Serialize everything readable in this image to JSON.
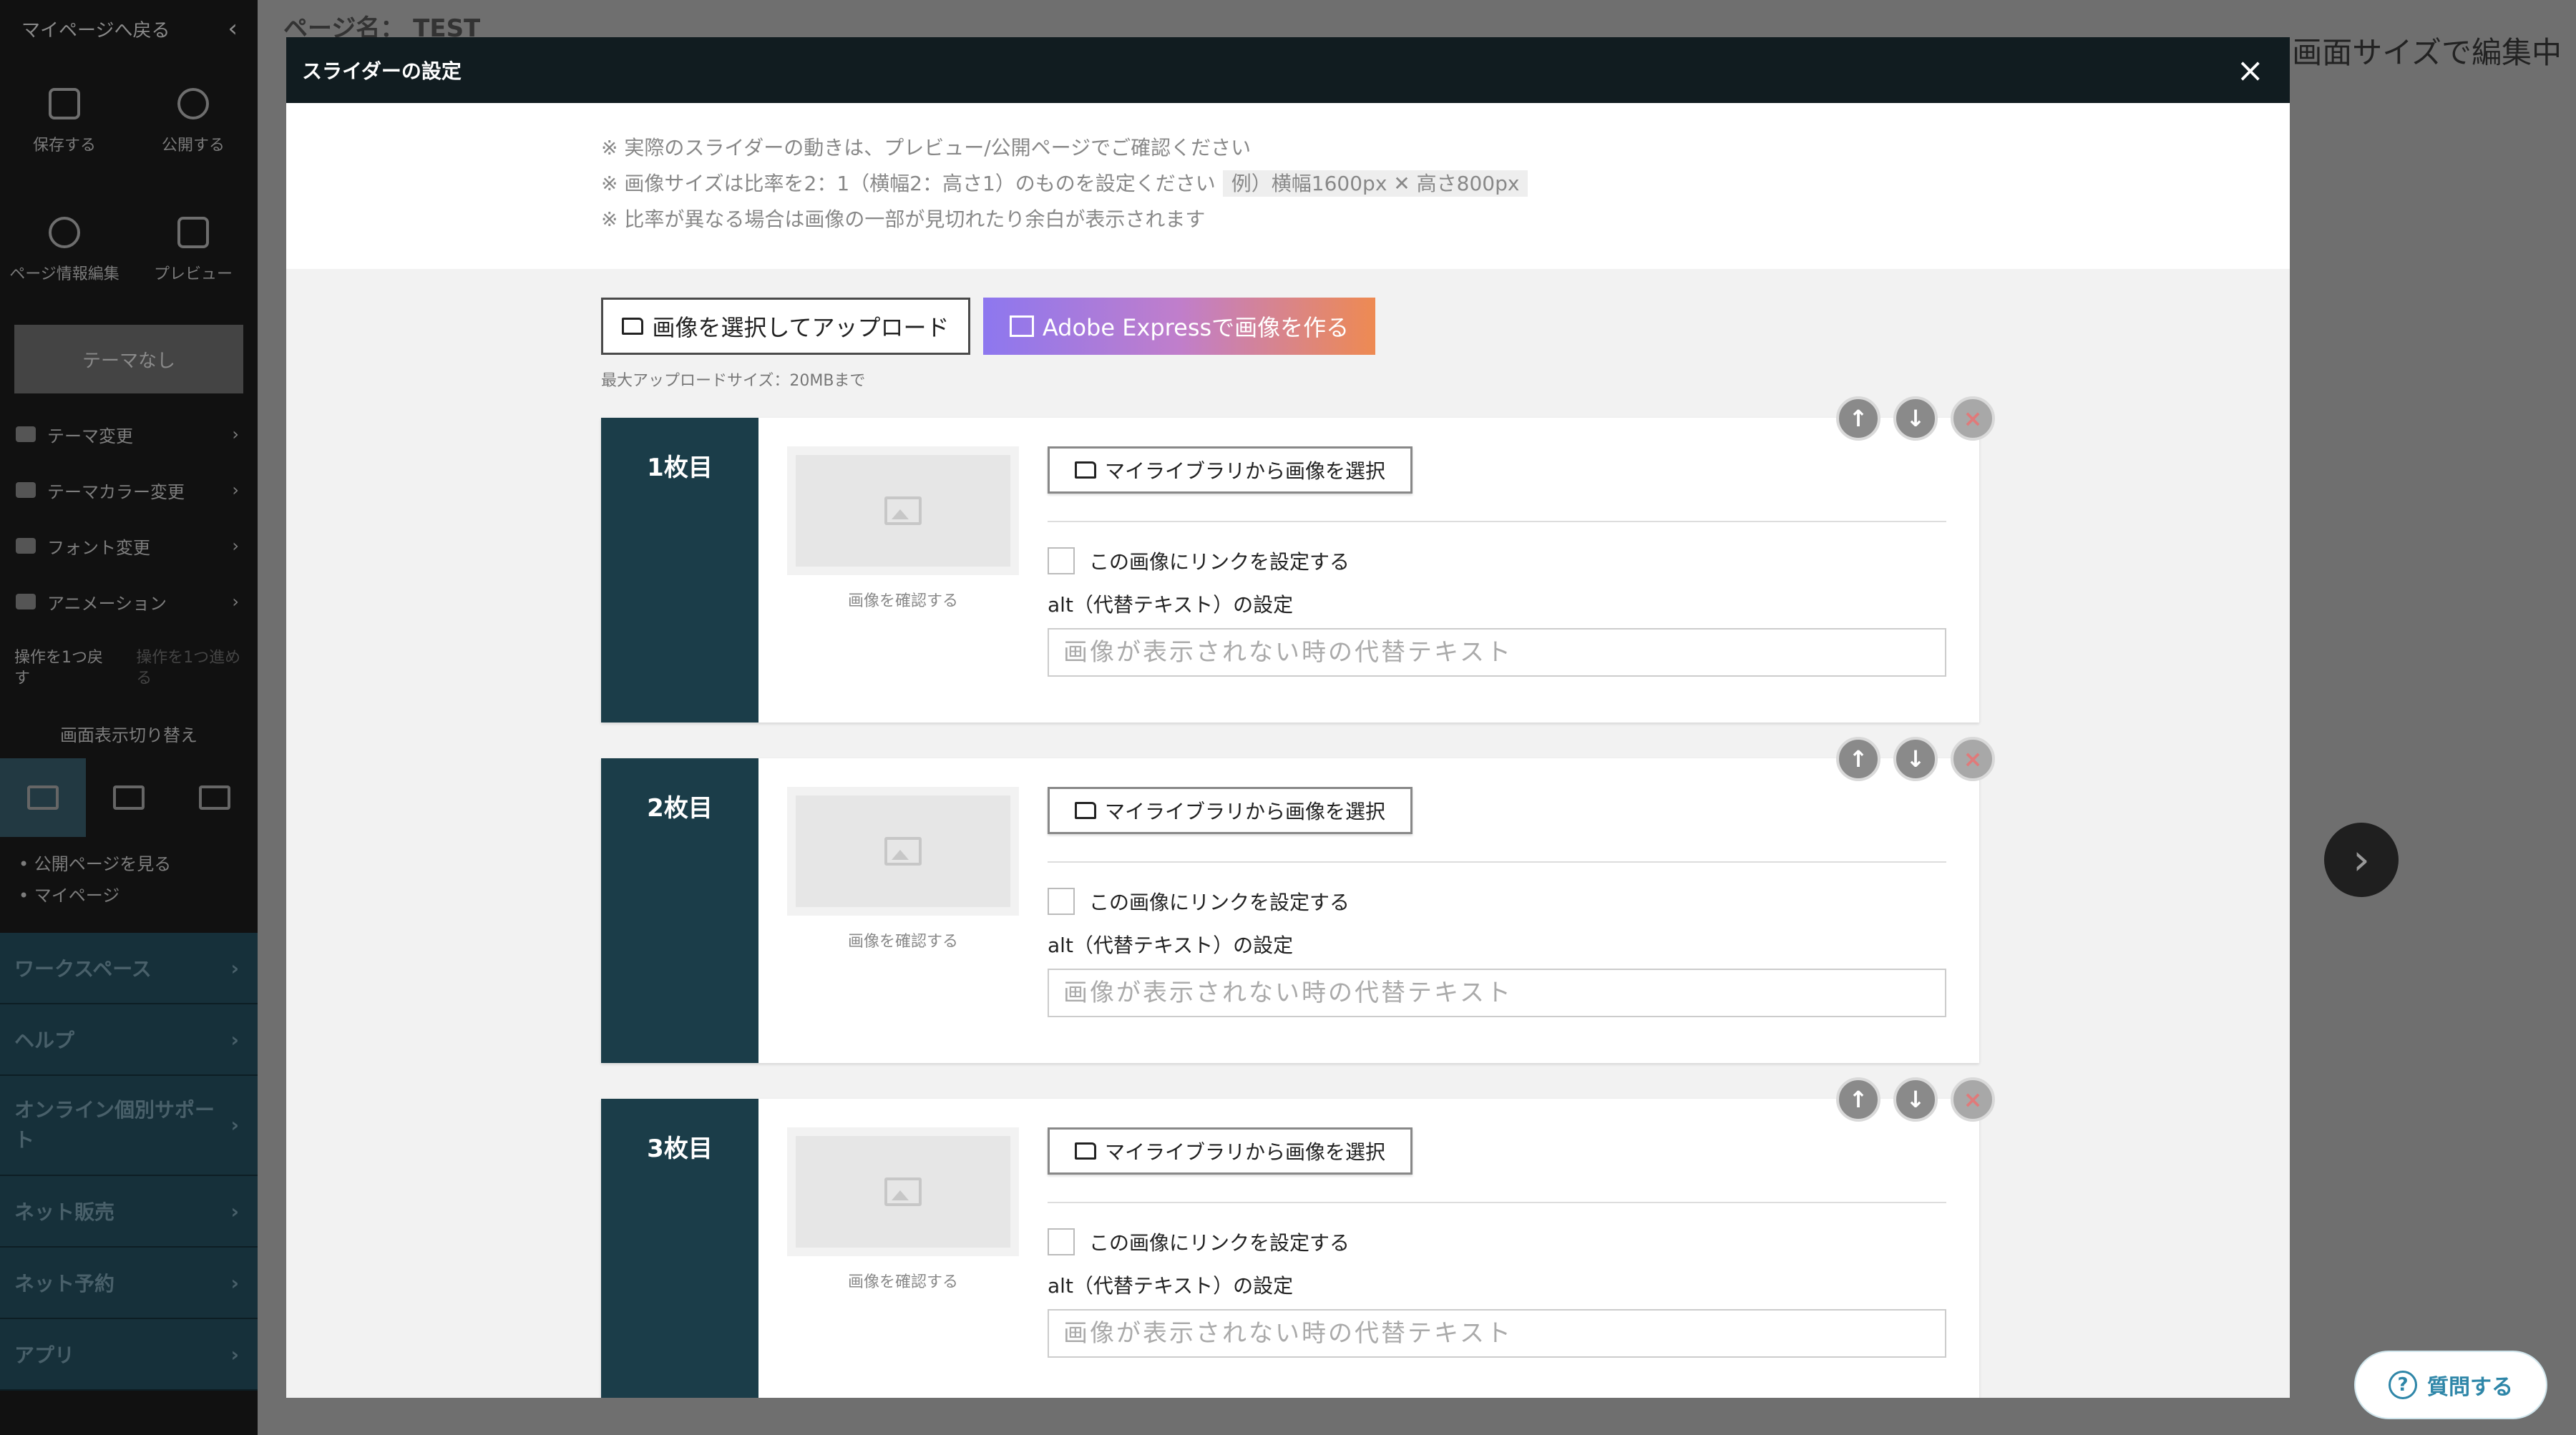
{
  "sidebar": {
    "back_label": "マイページへ戻る",
    "save_label": "保存する",
    "publish_label": "公開する",
    "page_info_label": "ページ情報編集",
    "preview_label": "プレビュー",
    "theme_button": "テーマなし",
    "menu": [
      {
        "label": "テーマ変更"
      },
      {
        "label": "テーマカラー変更"
      },
      {
        "label": "フォント変更"
      },
      {
        "label": "アニメーション"
      }
    ],
    "undo_label": "操作を1つ戻す",
    "redo_label": "操作を1つ進める",
    "display_switch_label": "画面表示切り替え",
    "links": [
      {
        "label": "• 公開ページを見る"
      },
      {
        "label": "• マイページ"
      }
    ],
    "sections": [
      {
        "label": "ワークスペース"
      },
      {
        "label": "ヘルプ"
      },
      {
        "label": "オンライン個別サポート"
      },
      {
        "label": "ネット販売"
      },
      {
        "label": "ネット予約"
      },
      {
        "label": "アプリ"
      }
    ]
  },
  "background": {
    "page_name": "ページ名： TEST",
    "editing_status": "の画面サイズで編集中"
  },
  "ask_button": {
    "label": "質問する"
  },
  "modal": {
    "title": "スライダーの設定",
    "notes": [
      "※ 実際のスライダーの動きは、プレビュー/公開ページでご確認ください",
      "※ 画像サイズは比率を2：1（横幅2：高さ1）のものを設定ください",
      "※ 比率が異なる場合は画像の一部が見切れたり余白が表示されます"
    ],
    "example_badge": "例）横幅1600px ✕ 高さ800px",
    "upload_button": "画像を選択してアップロード",
    "adobe_button": "Adobe Expressで画像を作る",
    "max_upload": "最大アップロードサイズ：20MBまで",
    "slides": [
      {
        "number": "1枚目"
      },
      {
        "number": "2枚目"
      },
      {
        "number": "3枚目"
      }
    ],
    "slide_texts": {
      "confirm_image": "画像を確認する",
      "library_button": "マイライブラリから画像を選択",
      "link_checkbox": "この画像にリンクを設定する",
      "alt_label": "alt（代替テキスト）の設定",
      "alt_placeholder": "画像が表示されない時の代替テキスト"
    }
  },
  "colors": {
    "header_bg": "#111c20",
    "slide_number_bg": "#1b3d49",
    "adobe_gradient_start": "#8d77ef",
    "adobe_gradient_end": "#ee8a52"
  }
}
